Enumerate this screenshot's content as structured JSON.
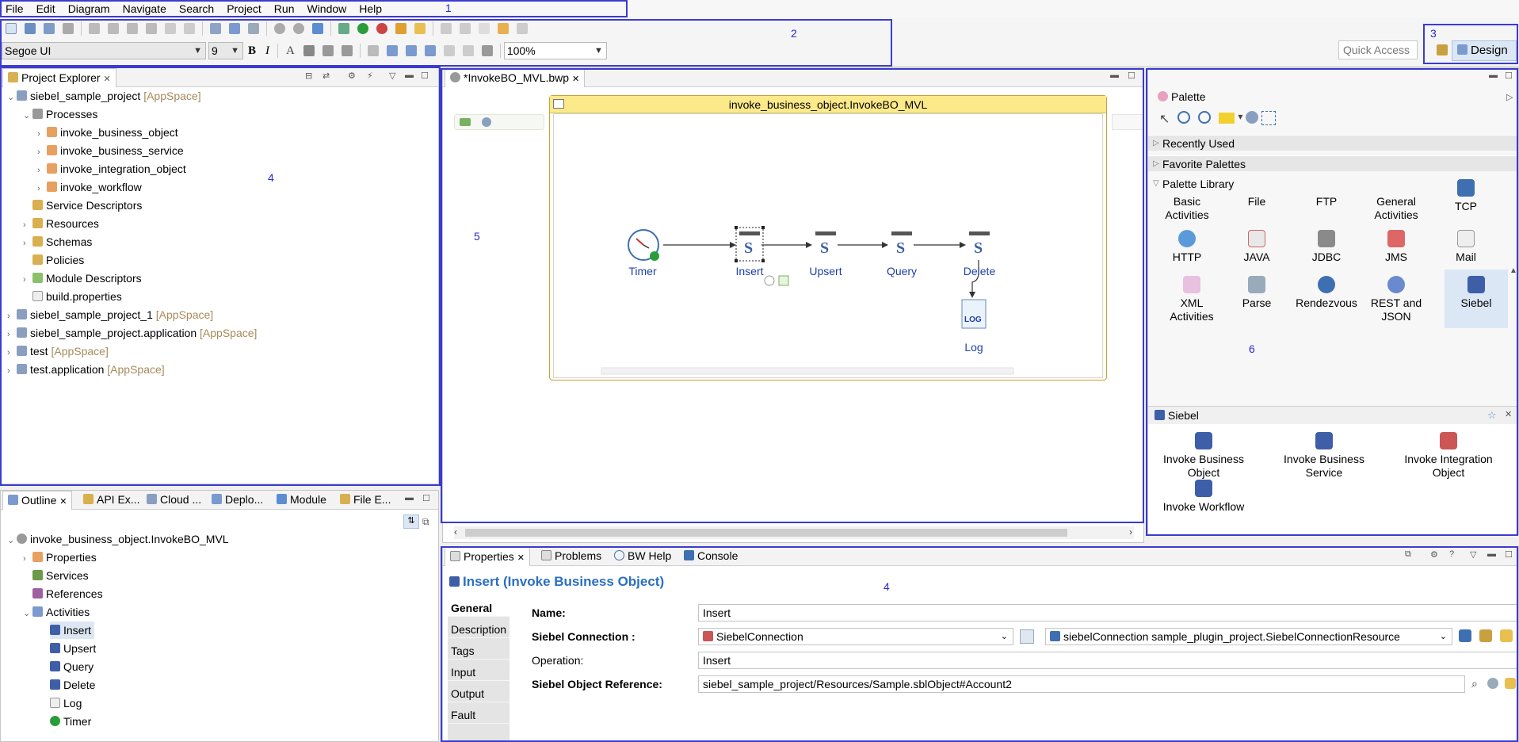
{
  "menu": [
    "File",
    "Edit",
    "Diagram",
    "Navigate",
    "Search",
    "Project",
    "Run",
    "Window",
    "Help"
  ],
  "toolbar": {
    "font": "Segoe UI",
    "size": "9",
    "bold": "B",
    "italic": "I",
    "text_a": "A",
    "zoom": "100%",
    "quick_access": "Quick Access",
    "design": "Design"
  },
  "annotations": [
    "1",
    "2",
    "3",
    "4",
    "5",
    "4",
    "6"
  ],
  "explorer": {
    "tab": "Project Explorer",
    "rows": [
      {
        "label": "siebel_sample_project",
        "tag": "[AppSpace]"
      },
      {
        "label": "Processes",
        "tag": ""
      },
      {
        "label": "invoke_business_object",
        "tag": ""
      },
      {
        "label": "invoke_business_service",
        "tag": ""
      },
      {
        "label": "invoke_integration_object",
        "tag": ""
      },
      {
        "label": "invoke_workflow",
        "tag": ""
      },
      {
        "label": "Service Descriptors",
        "tag": ""
      },
      {
        "label": "Resources",
        "tag": ""
      },
      {
        "label": "Schemas",
        "tag": ""
      },
      {
        "label": "Policies",
        "tag": ""
      },
      {
        "label": "Module Descriptors",
        "tag": ""
      },
      {
        "label": "build.properties",
        "tag": ""
      },
      {
        "label": "siebel_sample_project_1",
        "tag": "[AppSpace]"
      },
      {
        "label": "siebel_sample_project.application",
        "tag": "[AppSpace]"
      },
      {
        "label": "test",
        "tag": "[AppSpace]"
      },
      {
        "label": "test.application",
        "tag": "[AppSpace]"
      }
    ]
  },
  "outline": {
    "tabs": [
      "Outline",
      "API Ex...",
      "Cloud ...",
      "Deplo...",
      "Module",
      "File E..."
    ],
    "rows": [
      "invoke_business_object.InvokeBO_MVL",
      "Properties",
      "Services",
      "References",
      "Activities",
      "Insert",
      "Upsert",
      "Query",
      "Delete",
      "Log",
      "Timer"
    ]
  },
  "editor": {
    "tab": "*InvokeBO_MVL.bwp",
    "process_title": "invoke_business_object.InvokeBO_MVL",
    "nodes": [
      "Timer",
      "Insert",
      "Upsert",
      "Query",
      "Delete",
      "Log"
    ],
    "log_badge": "LOG"
  },
  "palette": {
    "title": "Palette",
    "sections": [
      "Recently Used",
      "Favorite Palettes",
      "Palette Library"
    ],
    "library": [
      [
        "Basic",
        "Activities"
      ],
      [
        "File",
        ""
      ],
      [
        "FTP",
        ""
      ],
      [
        "General",
        "Activities"
      ],
      [
        "TCP",
        ""
      ],
      [
        "HTTP",
        ""
      ],
      [
        "JAVA",
        ""
      ],
      [
        "JDBC",
        ""
      ],
      [
        "JMS",
        ""
      ],
      [
        "Mail",
        ""
      ],
      [
        "XML",
        "Activities"
      ],
      [
        "Parse",
        ""
      ],
      [
        "Rendezvous",
        ""
      ],
      [
        "REST and",
        "JSON"
      ],
      [
        "Siebel",
        ""
      ]
    ],
    "siebel_title": "Siebel",
    "siebel_items": [
      [
        "Invoke Business",
        "Object"
      ],
      [
        "Invoke Business",
        "Service"
      ],
      [
        "Invoke Integration",
        "Object"
      ],
      [
        "Invoke Workflow",
        ""
      ]
    ]
  },
  "properties": {
    "tabs": [
      "Properties",
      "Problems",
      "BW Help",
      "Console"
    ],
    "title": "Insert (Invoke Business Object)",
    "side_tabs": [
      "General",
      "Description",
      "Tags",
      "Input",
      "Output",
      "Fault"
    ],
    "name_label": "Name:",
    "name_value": "Insert",
    "conn_label": "Siebel Connection :",
    "conn_value": "SiebelConnection",
    "conn_resource": "siebelConnection sample_plugin_project.SiebelConnectionResource",
    "op_label": "Operation:",
    "op_value": "Insert",
    "ref_label": "Siebel Object Reference:",
    "ref_value": "siebel_sample_project/Resources/Sample.sblObject#Account2"
  }
}
